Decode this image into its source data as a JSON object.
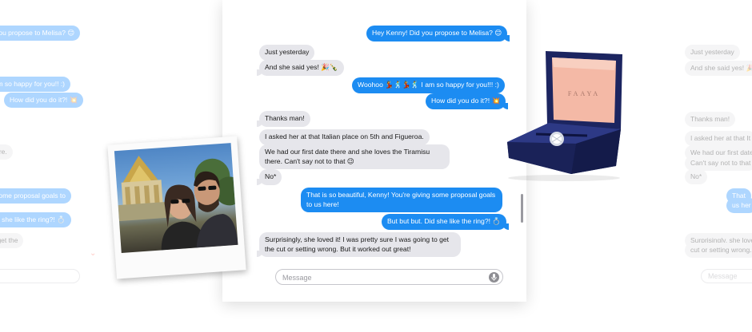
{
  "left_panel": {
    "bubbles": [
      {
        "text": "o you propose to Melisa? 😊",
        "type": "sent"
      },
      {
        "text": "I am so happy for you!! :)",
        "type": "sent"
      },
      {
        "text": "How did you do it?! 💥",
        "type": "sent"
      },
      {
        "text": "there.",
        "type": "recv"
      },
      {
        "text": "g some proposal goals to",
        "type": "sent"
      },
      {
        "text": "Did she like the ring?! 💍",
        "type": "sent"
      },
      {
        "text": "to get the",
        "type": "recv"
      }
    ]
  },
  "right_panel": {
    "bubbles": [
      {
        "text": "Just yesterday",
        "type": "recv"
      },
      {
        "text": "And she said yes! 🎉",
        "type": "recv"
      },
      {
        "text": "Thanks man!",
        "type": "recv"
      },
      {
        "text": "I asked her at that It",
        "type": "recv"
      },
      {
        "text": "We had our first date",
        "type": "recv"
      },
      {
        "text": "Can't say not to that",
        "type": "recv"
      },
      {
        "text": "No*",
        "type": "recv"
      },
      {
        "text": "That",
        "type": "sent"
      },
      {
        "text": "us her",
        "type": "sent"
      },
      {
        "text": "Surprisingly, she love",
        "type": "recv"
      },
      {
        "text": "cut or setting wrong.",
        "type": "recv"
      }
    ],
    "input_placeholder": "Message"
  },
  "chat": {
    "messages": [
      {
        "text": "Hey Kenny! Did you propose to Melisa? 😊",
        "type": "sent"
      },
      {
        "text": "Just yesterday",
        "type": "recv"
      },
      {
        "text": "And she said yes! 🎉🍾",
        "type": "recv"
      },
      {
        "text": "Woohoo 💃🕺💃🕺 I am so happy for you!!! :)",
        "type": "sent"
      },
      {
        "text": "How did you do it?! 💥",
        "type": "sent"
      },
      {
        "text": "Thanks man!",
        "type": "recv"
      },
      {
        "text": "I asked her at that Italian place on 5th and Figueroa.",
        "type": "recv"
      },
      {
        "text": "We had our first date there and she loves the Tiramisu there. Can't say not to that 😉",
        "type": "recv"
      },
      {
        "text": "No*",
        "type": "recv"
      },
      {
        "text": "That is so beautiful, Kenny! You're giving some proposal goals to us here!",
        "type": "sent"
      },
      {
        "text": "But but but. Did she like the ring?! 💍",
        "type": "sent"
      },
      {
        "text": "Surprisingly, she loved it! I was pretty sure I was going to get the cut or setting wrong. But it worked out great!",
        "type": "recv"
      }
    ],
    "input_placeholder": "Message"
  },
  "ring_box": {
    "brand": "FAAYA"
  },
  "colors": {
    "sent": "#1c8cf2",
    "received": "#e6e6eb",
    "ring_box": "#1b2a6b",
    "box_lining": "#f4b9a6"
  }
}
